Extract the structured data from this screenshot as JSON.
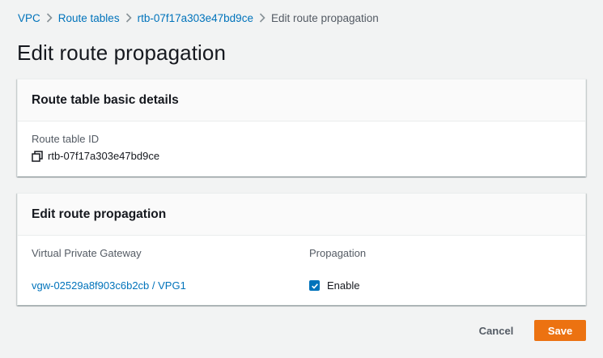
{
  "breadcrumb": {
    "items": [
      "VPC",
      "Route tables",
      "rtb-07f17a303e47bd9ce"
    ],
    "current": "Edit route propagation"
  },
  "page": {
    "title": "Edit route propagation"
  },
  "details_panel": {
    "title": "Route table basic details",
    "route_table_id_label": "Route table ID",
    "route_table_id_value": "rtb-07f17a303e47bd9ce"
  },
  "propagation_panel": {
    "title": "Edit route propagation",
    "col_gateway": "Virtual Private Gateway",
    "col_propagation": "Propagation",
    "rows": [
      {
        "gateway": "vgw-02529a8f903c6b2cb / VPG1",
        "propagation_label": "Enable",
        "checked": true
      }
    ]
  },
  "actions": {
    "cancel": "Cancel",
    "save": "Save"
  },
  "colors": {
    "link": "#0073bb",
    "primary": "#ec7211",
    "background": "#f2f3f3"
  },
  "icons": {
    "separator": "chevron-right-icon",
    "copy": "copy-icon",
    "check": "checkmark-icon"
  }
}
